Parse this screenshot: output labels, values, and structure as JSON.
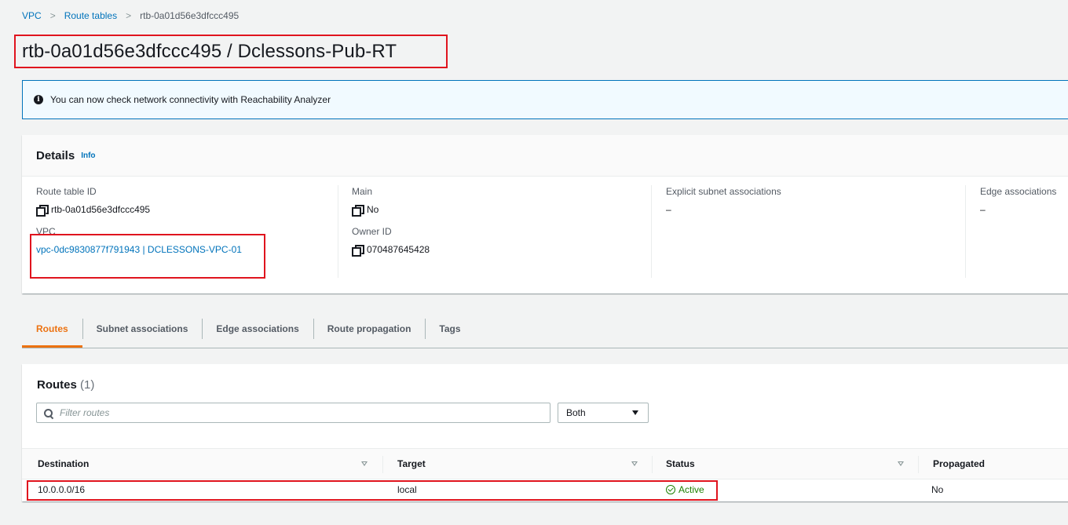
{
  "breadcrumb": {
    "items": [
      {
        "label": "VPC"
      },
      {
        "label": "Route tables"
      },
      {
        "label": "rtb-0a01d56e3dfccc495"
      }
    ]
  },
  "page_title": "rtb-0a01d56e3dfccc495 / Dclessons-Pub-RT",
  "flash": {
    "icon": "info-icon",
    "message": "You can now check network connectivity with Reachability Analyzer"
  },
  "details": {
    "title": "Details",
    "info_link": "Info",
    "fields": {
      "route_table_id": {
        "label": "Route table ID",
        "value": "rtb-0a01d56e3dfccc495"
      },
      "vpc": {
        "label": "VPC",
        "value": "vpc-0dc9830877f791943 | DCLESSONS-VPC-01"
      },
      "main": {
        "label": "Main",
        "value": "No"
      },
      "owner_id": {
        "label": "Owner ID",
        "value": "070487645428"
      },
      "explicit_subnet": {
        "label": "Explicit subnet associations",
        "value": "–"
      },
      "edge": {
        "label": "Edge associations",
        "value": "–"
      }
    }
  },
  "tabs": [
    {
      "label": "Routes",
      "active": true
    },
    {
      "label": "Subnet associations",
      "active": false
    },
    {
      "label": "Edge associations",
      "active": false
    },
    {
      "label": "Route propagation",
      "active": false
    },
    {
      "label": "Tags",
      "active": false
    }
  ],
  "routes": {
    "title": "Routes",
    "count": "(1)",
    "filter_placeholder": "Filter routes",
    "select_value": "Both",
    "columns": [
      "Destination",
      "Target",
      "Status",
      "Propagated"
    ],
    "rows": [
      {
        "destination": "10.0.0.0/16",
        "target": "local",
        "status": "Active",
        "propagated": "No"
      }
    ]
  },
  "colors": {
    "accent_orange": "#ec7211",
    "link_blue": "#0073bb",
    "status_green": "#1d8102",
    "highlight_red": "#e0141e"
  }
}
